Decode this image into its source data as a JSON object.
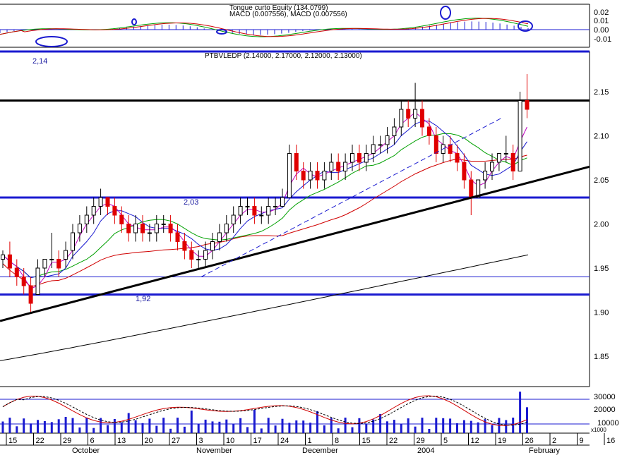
{
  "chart_data": {
    "type": "candlestick",
    "macd_panel": {
      "header_line1": "Tongue curto Equity (134.0799)",
      "header_line2": "MACD (0.007556), MACD (0.007556)",
      "ytick_labels": [
        "0.02",
        "0.01",
        "0.00",
        "-0.01"
      ],
      "ylim": [
        -0.018,
        0.028
      ]
    },
    "price_panel": {
      "title": "PTBVLEDP (2.14000, 2.17000, 2.12000, 2.13000)",
      "ylim": [
        1.81,
        2.18
      ],
      "ytick_labels": [
        "2.15",
        "2.10",
        "2.05",
        "2.00",
        "1.95",
        "1.90",
        "1.85"
      ],
      "yticks": [
        2.15,
        2.1,
        2.05,
        2.0,
        1.95,
        1.9,
        1.85
      ],
      "level_labels": [
        "2,14",
        "2,03",
        "1,92"
      ],
      "horizontal_levels": [
        2.14,
        2.03,
        1.94,
        1.92
      ],
      "ohlc_sample": [
        {
          "o": 1.96,
          "h": 1.97,
          "l": 1.95,
          "c": 1.965
        },
        {
          "o": 1.965,
          "h": 1.98,
          "l": 1.94,
          "c": 1.95
        },
        {
          "o": 1.95,
          "h": 1.96,
          "l": 1.93,
          "c": 1.94
        },
        {
          "o": 1.94,
          "h": 1.95,
          "l": 1.92,
          "c": 1.93
        },
        {
          "o": 1.93,
          "h": 1.94,
          "l": 1.9,
          "c": 1.91
        },
        {
          "o": 1.92,
          "h": 1.96,
          "l": 1.92,
          "c": 1.95
        },
        {
          "o": 1.95,
          "h": 1.96,
          "l": 1.94,
          "c": 1.96
        },
        {
          "o": 1.96,
          "h": 1.99,
          "l": 1.95,
          "c": 1.96
        },
        {
          "o": 1.96,
          "h": 1.97,
          "l": 1.94,
          "c": 1.95
        },
        {
          "o": 1.96,
          "h": 1.98,
          "l": 1.95,
          "c": 1.97
        },
        {
          "o": 1.97,
          "h": 2.0,
          "l": 1.96,
          "c": 1.99
        },
        {
          "o": 1.99,
          "h": 2.01,
          "l": 1.98,
          "c": 2.0
        },
        {
          "o": 2.0,
          "h": 2.02,
          "l": 1.99,
          "c": 2.01
        },
        {
          "o": 2.01,
          "h": 2.03,
          "l": 2.0,
          "c": 2.02
        },
        {
          "o": 2.02,
          "h": 2.04,
          "l": 2.01,
          "c": 2.03
        },
        {
          "o": 2.03,
          "h": 2.03,
          "l": 2.01,
          "c": 2.02
        },
        {
          "o": 2.02,
          "h": 2.03,
          "l": 2.0,
          "c": 2.01
        },
        {
          "o": 2.01,
          "h": 2.02,
          "l": 1.99,
          "c": 2.0
        },
        {
          "o": 2.0,
          "h": 2.01,
          "l": 1.98,
          "c": 1.99
        },
        {
          "o": 1.99,
          "h": 2.01,
          "l": 1.98,
          "c": 2.0
        },
        {
          "o": 2.0,
          "h": 2.01,
          "l": 1.98,
          "c": 1.99
        },
        {
          "o": 1.99,
          "h": 2.0,
          "l": 1.98,
          "c": 1.99
        },
        {
          "o": 1.99,
          "h": 2.01,
          "l": 1.98,
          "c": 2.0
        },
        {
          "o": 2.0,
          "h": 2.01,
          "l": 1.99,
          "c": 2.0
        },
        {
          "o": 2.0,
          "h": 2.01,
          "l": 1.98,
          "c": 1.99
        },
        {
          "o": 1.99,
          "h": 2.0,
          "l": 1.97,
          "c": 1.98
        },
        {
          "o": 1.98,
          "h": 1.99,
          "l": 1.96,
          "c": 1.97
        },
        {
          "o": 1.97,
          "h": 1.98,
          "l": 1.95,
          "c": 1.96
        },
        {
          "o": 1.96,
          "h": 1.97,
          "l": 1.95,
          "c": 1.96
        },
        {
          "o": 1.96,
          "h": 1.98,
          "l": 1.95,
          "c": 1.97
        },
        {
          "o": 1.97,
          "h": 1.99,
          "l": 1.96,
          "c": 1.98
        },
        {
          "o": 1.98,
          "h": 2.0,
          "l": 1.97,
          "c": 1.99
        },
        {
          "o": 1.99,
          "h": 2.01,
          "l": 1.98,
          "c": 2.0
        },
        {
          "o": 2.0,
          "h": 2.02,
          "l": 1.99,
          "c": 2.01
        },
        {
          "o": 2.01,
          "h": 2.03,
          "l": 2.0,
          "c": 2.02
        },
        {
          "o": 2.02,
          "h": 2.03,
          "l": 2.01,
          "c": 2.02
        },
        {
          "o": 2.02,
          "h": 2.03,
          "l": 2.0,
          "c": 2.01
        },
        {
          "o": 2.01,
          "h": 2.02,
          "l": 2.0,
          "c": 2.01
        },
        {
          "o": 2.01,
          "h": 2.03,
          "l": 2.0,
          "c": 2.02
        },
        {
          "o": 2.02,
          "h": 2.03,
          "l": 2.01,
          "c": 2.02
        },
        {
          "o": 2.02,
          "h": 2.04,
          "l": 2.02,
          "c": 2.03
        },
        {
          "o": 2.03,
          "h": 2.09,
          "l": 2.03,
          "c": 2.08
        },
        {
          "o": 2.08,
          "h": 2.09,
          "l": 2.05,
          "c": 2.06
        },
        {
          "o": 2.06,
          "h": 2.07,
          "l": 2.04,
          "c": 2.05
        },
        {
          "o": 2.05,
          "h": 2.07,
          "l": 2.04,
          "c": 2.06
        },
        {
          "o": 2.06,
          "h": 2.07,
          "l": 2.04,
          "c": 2.05
        },
        {
          "o": 2.05,
          "h": 2.07,
          "l": 2.04,
          "c": 2.06
        },
        {
          "o": 2.06,
          "h": 2.08,
          "l": 2.05,
          "c": 2.07
        },
        {
          "o": 2.07,
          "h": 2.08,
          "l": 2.05,
          "c": 2.06
        },
        {
          "o": 2.06,
          "h": 2.08,
          "l": 2.05,
          "c": 2.07
        },
        {
          "o": 2.07,
          "h": 2.09,
          "l": 2.06,
          "c": 2.08
        },
        {
          "o": 2.08,
          "h": 2.09,
          "l": 2.06,
          "c": 2.07
        },
        {
          "o": 2.07,
          "h": 2.09,
          "l": 2.06,
          "c": 2.08
        },
        {
          "o": 2.08,
          "h": 2.1,
          "l": 2.07,
          "c": 2.09
        },
        {
          "o": 2.09,
          "h": 2.1,
          "l": 2.08,
          "c": 2.09
        },
        {
          "o": 2.09,
          "h": 2.11,
          "l": 2.08,
          "c": 2.1
        },
        {
          "o": 2.1,
          "h": 2.12,
          "l": 2.09,
          "c": 2.11
        },
        {
          "o": 2.11,
          "h": 2.14,
          "l": 2.1,
          "c": 2.13
        },
        {
          "o": 2.13,
          "h": 2.14,
          "l": 2.11,
          "c": 2.12
        },
        {
          "o": 2.12,
          "h": 2.16,
          "l": 2.11,
          "c": 2.13
        },
        {
          "o": 2.13,
          "h": 2.14,
          "l": 2.1,
          "c": 2.11
        },
        {
          "o": 2.11,
          "h": 2.12,
          "l": 2.09,
          "c": 2.1
        },
        {
          "o": 2.1,
          "h": 2.11,
          "l": 2.07,
          "c": 2.08
        },
        {
          "o": 2.08,
          "h": 2.1,
          "l": 2.07,
          "c": 2.09
        },
        {
          "o": 2.09,
          "h": 2.1,
          "l": 2.07,
          "c": 2.08
        },
        {
          "o": 2.08,
          "h": 2.09,
          "l": 2.06,
          "c": 2.07
        },
        {
          "o": 2.07,
          "h": 2.08,
          "l": 2.04,
          "c": 2.05
        },
        {
          "o": 2.05,
          "h": 2.06,
          "l": 2.01,
          "c": 2.03
        },
        {
          "o": 2.03,
          "h": 2.05,
          "l": 2.03,
          "c": 2.05
        },
        {
          "o": 2.05,
          "h": 2.07,
          "l": 2.04,
          "c": 2.06
        },
        {
          "o": 2.06,
          "h": 2.08,
          "l": 2.05,
          "c": 2.07
        },
        {
          "o": 2.07,
          "h": 2.08,
          "l": 2.06,
          "c": 2.08
        },
        {
          "o": 2.08,
          "h": 2.1,
          "l": 2.07,
          "c": 2.08
        },
        {
          "o": 2.08,
          "h": 2.09,
          "l": 2.05,
          "c": 2.06
        },
        {
          "o": 2.06,
          "h": 2.15,
          "l": 2.06,
          "c": 2.14
        },
        {
          "o": 2.14,
          "h": 2.17,
          "l": 2.12,
          "c": 2.13
        }
      ]
    },
    "volume_panel": {
      "ytick_labels": [
        "30000",
        "20000",
        "10000"
      ],
      "multiplier_label": "x1000",
      "ylim": [
        0,
        36000
      ]
    },
    "x_axis": {
      "tick_labels": [
        "15",
        "22",
        "29",
        "6",
        "13",
        "20",
        "27",
        "3",
        "10",
        "17",
        "24",
        "1",
        "8",
        "15",
        "22",
        "29",
        "5",
        "12",
        "19",
        "26",
        "2",
        "9",
        "16"
      ],
      "month_labels": [
        "October",
        "November",
        "December",
        "2004",
        "February"
      ]
    }
  }
}
